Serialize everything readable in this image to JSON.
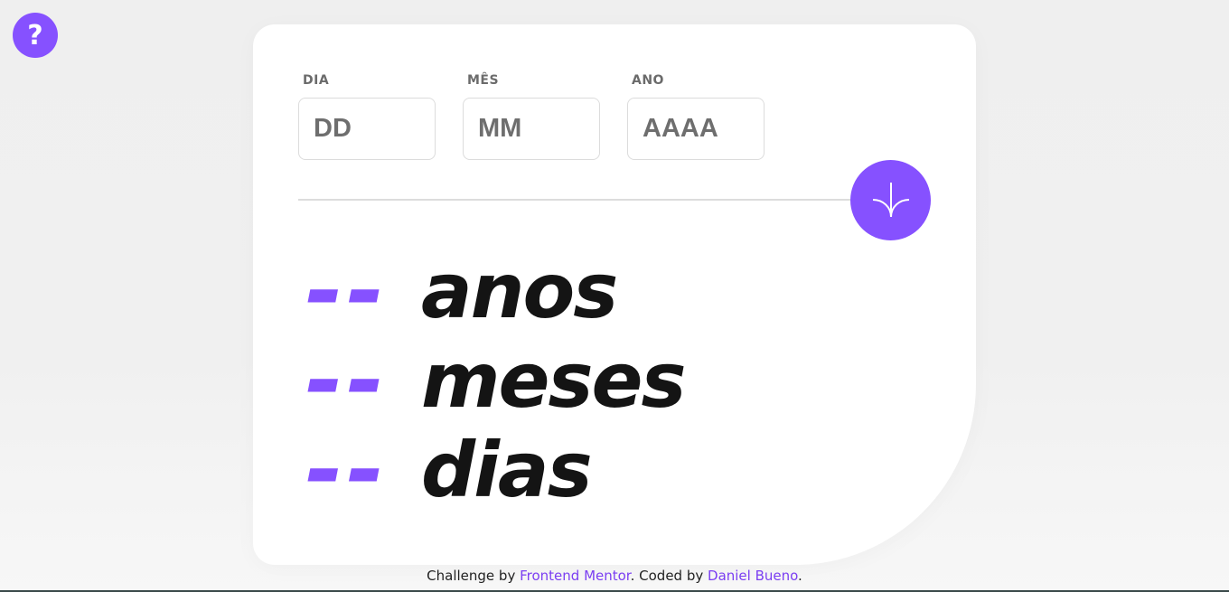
{
  "help": {
    "glyph": "?"
  },
  "form": {
    "day": {
      "label": "DIA",
      "placeholder": "DD",
      "value": ""
    },
    "month": {
      "label": "MÊS",
      "placeholder": "MM",
      "value": ""
    },
    "year": {
      "label": "ANO",
      "placeholder": "AAAA",
      "value": ""
    },
    "submit_icon": "arrow-down-icon"
  },
  "results": {
    "years": {
      "value": "--",
      "unit": "anos"
    },
    "months": {
      "value": "--",
      "unit": "meses"
    },
    "days": {
      "value": "--",
      "unit": "dias"
    }
  },
  "attribution": {
    "prefix": "Challenge by ",
    "challenge_link": "Frontend Mentor",
    "middle": ". Coded by ",
    "author_link": "Daniel Bueno",
    "suffix": "."
  },
  "colors": {
    "accent": "#8651ff",
    "text_dark": "#141414",
    "label_gray": "#6b6b6b",
    "border": "#dcdcdc"
  }
}
